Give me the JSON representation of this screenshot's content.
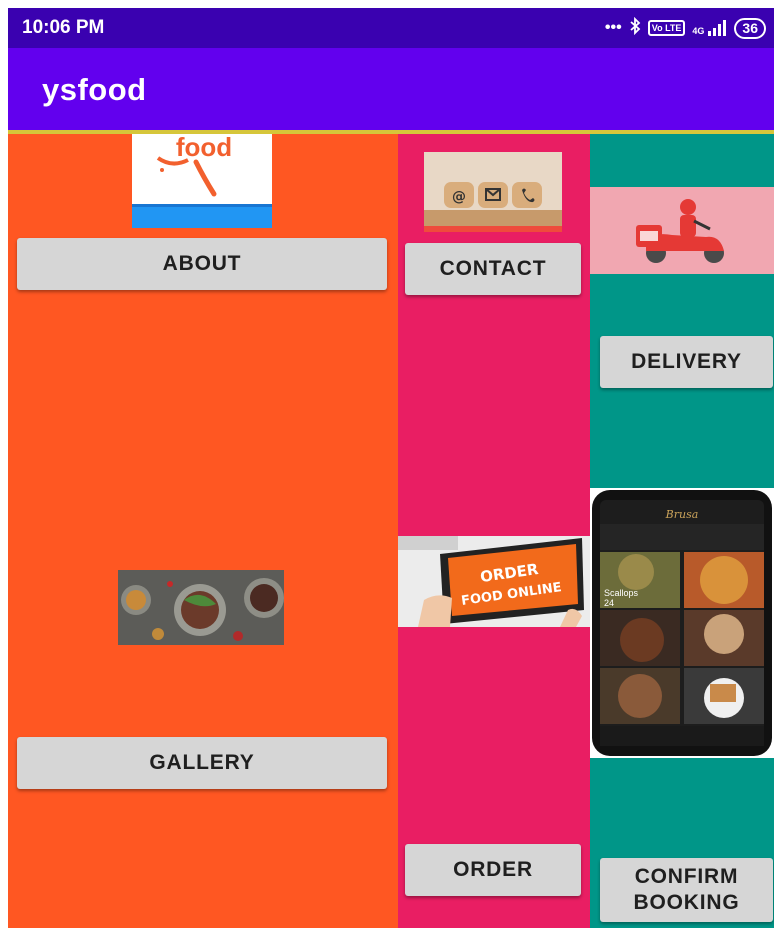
{
  "status_bar": {
    "time": "10:06 PM",
    "dots": "•••",
    "network": "4G",
    "volte": "Vo LTE",
    "battery": "36"
  },
  "app_bar": {
    "title": "ysfood"
  },
  "colors": {
    "app_bar": "#6200ee",
    "status_bar": "#3a01b0",
    "orange": "#ff5722",
    "pink": "#e91e63",
    "teal": "#009688",
    "button": "#d6d6d6"
  },
  "buttons": {
    "about": "ABOUT",
    "contact": "CONTACT",
    "delivery": "DELIVERY",
    "gallery": "GALLERY",
    "order": "ORDER",
    "confirm_booking": "CONFIRM BOOKING"
  },
  "images": {
    "food_logo_text": "food",
    "order_text_line1": "ORDER",
    "order_text_line2": "FOOD ONLINE",
    "phone_app_name": "Brusa",
    "phone_item_label": "Scallops",
    "phone_item_price": "24"
  }
}
